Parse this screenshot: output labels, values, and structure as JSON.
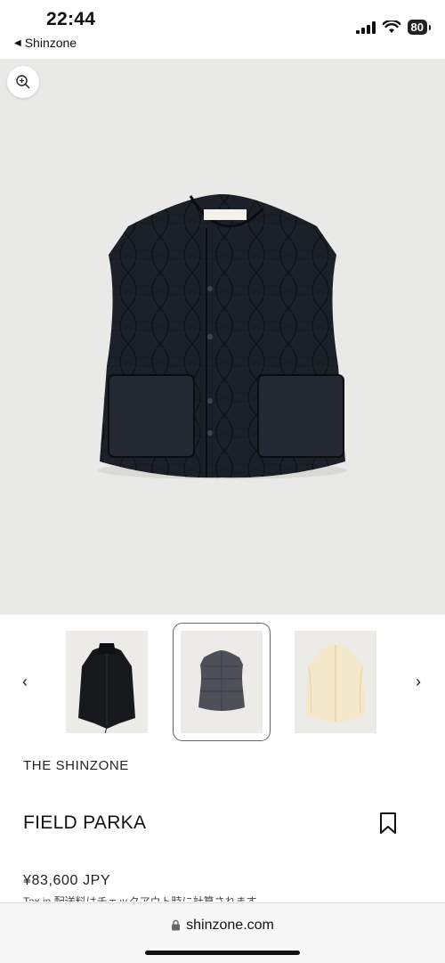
{
  "status": {
    "time": "22:44",
    "back_label": "Shinzone",
    "battery": "80"
  },
  "product": {
    "brand": "THE SHINZONE",
    "title": "FIELD PARKA",
    "price": "¥83,600 JPY",
    "tax_note": "Tax in 配送料はチェックアウト時に計算されます"
  },
  "thumbnails": [
    {
      "name": "black-long-parka",
      "selected": false
    },
    {
      "name": "grey-quilted-vest",
      "selected": true
    },
    {
      "name": "cream-parka",
      "selected": false
    }
  ],
  "browser": {
    "url": "shinzone.com"
  },
  "colors": {
    "vest": "#1c2028",
    "hero_bg": "#e9e9e7"
  }
}
